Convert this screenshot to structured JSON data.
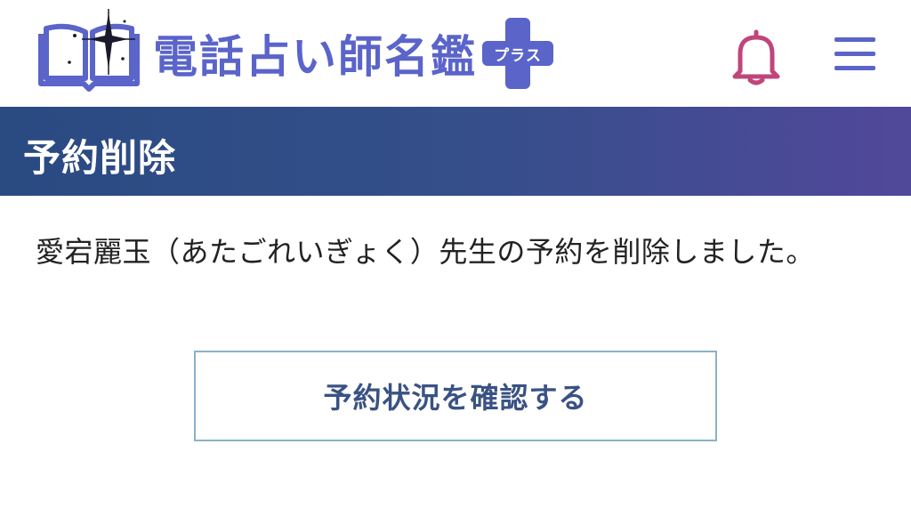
{
  "header": {
    "logo_text": "電話占い師名鑑",
    "logo_plus_label": "プラス",
    "logo_icon": "open-book-star-icon",
    "bell_icon": "bell-icon",
    "menu_icon": "hamburger-menu-icon",
    "brand_color": "#5a64c9",
    "bell_color": "#c0457a"
  },
  "page": {
    "title": "予約削除",
    "title_bar_colors": [
      "#2a4a82",
      "#51489a"
    ],
    "message": "愛宕麗玉（あたごれいぎょく）先生の予約を削除しました。",
    "button_label": "予約状況を確認する"
  }
}
